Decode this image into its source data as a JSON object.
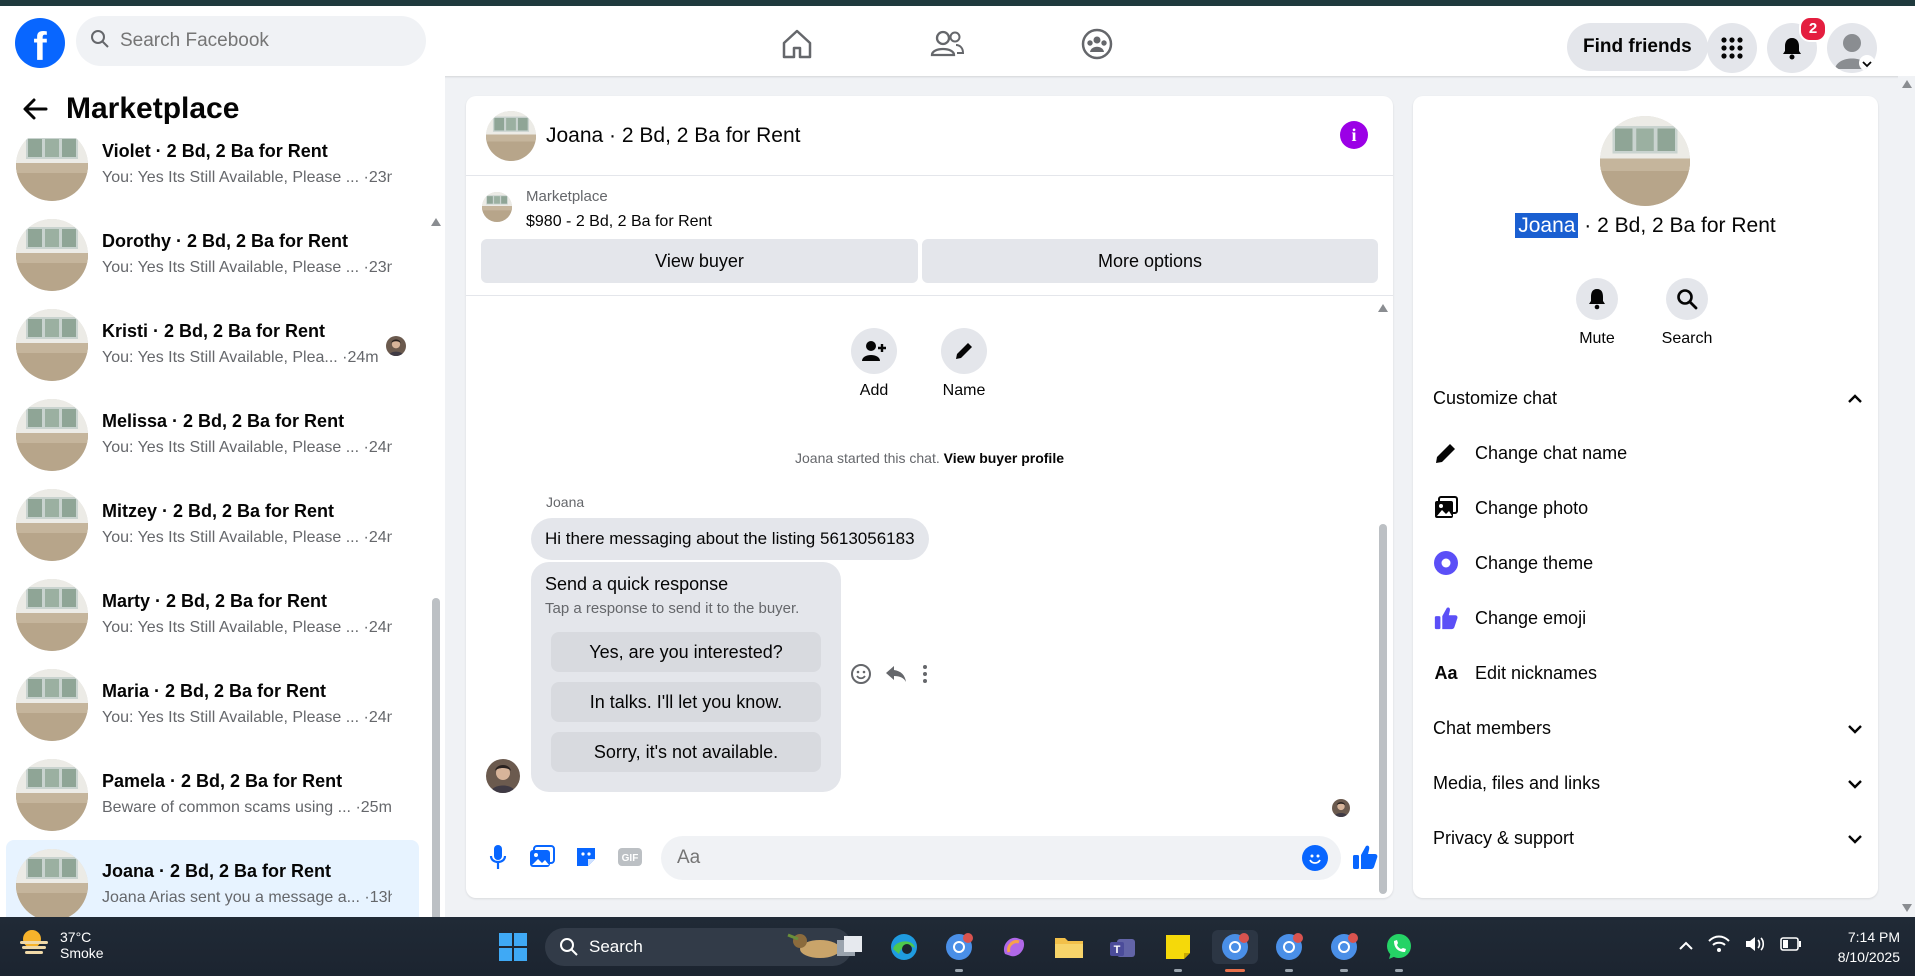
{
  "topbar": {
    "logo": "f",
    "search_placeholder": "Search Facebook",
    "find_friends": "Find friends",
    "notification_count": "2"
  },
  "sidebar": {
    "title": "Marketplace",
    "conversations": [
      {
        "name": "Violet · 2 Bd, 2 Ba for Rent",
        "message": "You: Yes Its Still Available, Please ...",
        "time": "·23m"
      },
      {
        "name": "Dorothy · 2 Bd, 2 Ba for Rent",
        "message": "You: Yes Its Still Available, Please ...",
        "time": "·23m"
      },
      {
        "name": "Kristi · 2 Bd, 2 Ba for Rent",
        "message": "You: Yes Its Still Available, Plea...",
        "time": "·24m"
      },
      {
        "name": "Melissa · 2 Bd, 2 Ba for Rent",
        "message": "You: Yes Its Still Available, Please ...",
        "time": "·24m"
      },
      {
        "name": "Mitzey · 2 Bd, 2 Ba for Rent",
        "message": "You: Yes Its Still Available, Please ...",
        "time": "·24m"
      },
      {
        "name": "Marty · 2 Bd, 2 Ba for Rent",
        "message": "You: Yes Its Still Available, Please ...",
        "time": "·24m"
      },
      {
        "name": "Maria · 2 Bd, 2 Ba for Rent",
        "message": "You: Yes Its Still Available, Please ...",
        "time": "·24m"
      },
      {
        "name": "Pamela · 2 Bd, 2 Ba for Rent",
        "message": "Beware of common scams using ...",
        "time": "·25m"
      },
      {
        "name": "Joana · 2 Bd, 2 Ba for Rent",
        "message": "Joana Arias sent you a message a...",
        "time": "·13h"
      }
    ]
  },
  "chat": {
    "title": "Joana · 2 Bd, 2 Ba for Rent",
    "listing_source": "Marketplace",
    "listing_price": "$980 - 2 Bd, 2 Ba for Rent",
    "view_buyer": "View buyer",
    "more_options": "More options",
    "add_label": "Add",
    "name_label": "Name",
    "system_text": "Joana started this chat.",
    "system_link": "View buyer profile",
    "sender": "Joana",
    "message": "Hi there messaging about the listing 5613056183",
    "quick_title": "Send a quick response",
    "quick_subtitle": "Tap a response to send it to the buyer.",
    "quick_options": [
      "Yes, are you interested?",
      "In talks. I'll let you know.",
      "Sorry, it's not available."
    ],
    "input_placeholder": "Aa"
  },
  "details": {
    "name_highlight": "Joana",
    "name_rest": " · 2 Bd, 2 Ba for Rent",
    "mute": "Mute",
    "search": "Search",
    "customize_chat": "Customize chat",
    "change_chat_name": "Change chat name",
    "change_photo": "Change photo",
    "change_theme": "Change theme",
    "change_emoji": "Change emoji",
    "edit_nicknames": "Edit nicknames",
    "nicknames_icon_text": "Aa",
    "chat_members": "Chat members",
    "media_files": "Media, files and links",
    "privacy_support": "Privacy & support"
  },
  "taskbar": {
    "temperature": "37°C",
    "weather": "Smoke",
    "search": "Search",
    "time": "7:14 PM",
    "date": "8/10/2025"
  },
  "colors": {
    "brand": "#0866ff",
    "active_conv": "#e7f3ff",
    "info": "#9b00e6",
    "badge": "#e41e3f",
    "theme_accent": "#5b4ff7"
  }
}
